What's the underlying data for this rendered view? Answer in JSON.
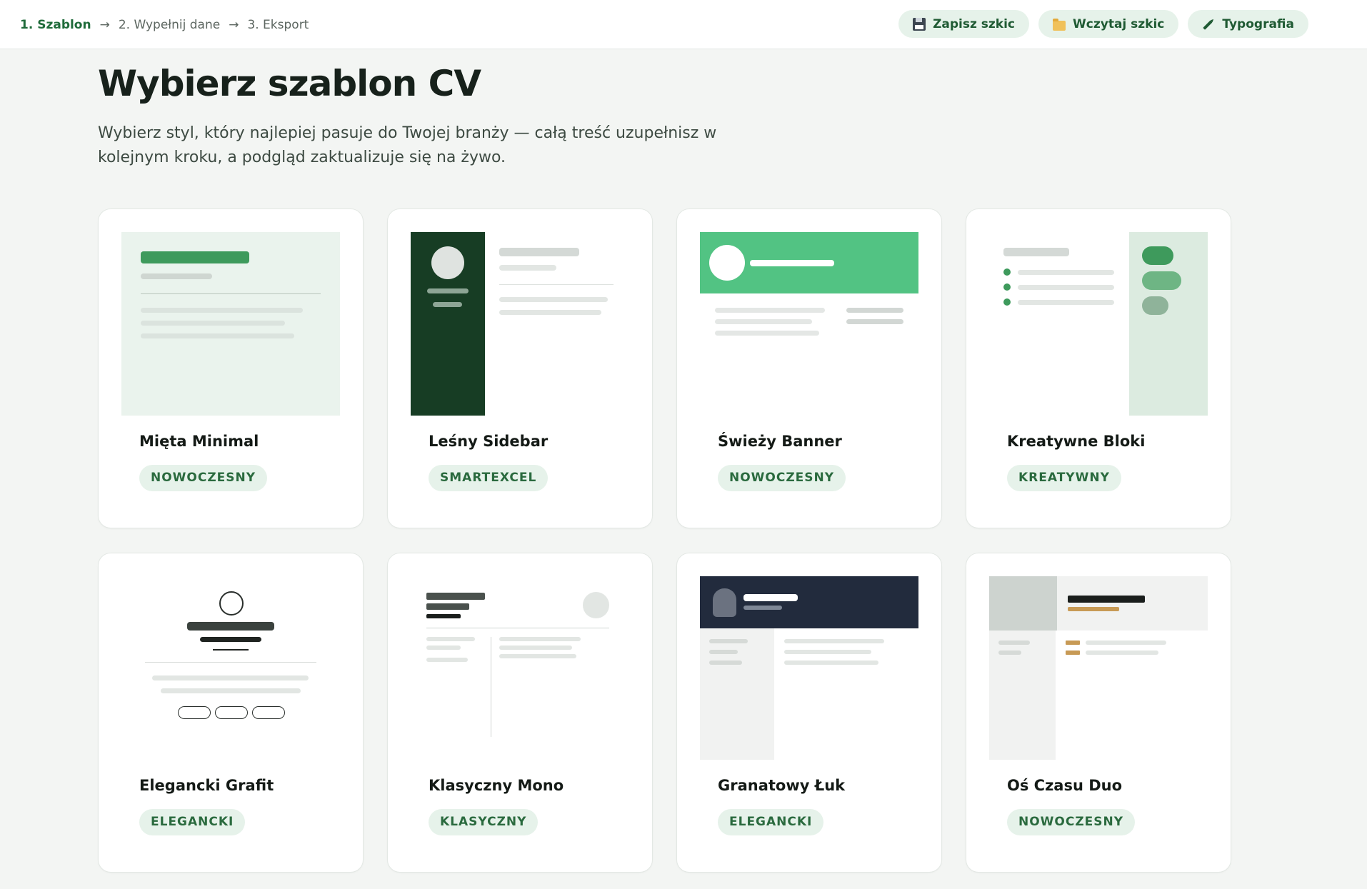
{
  "steps": [
    {
      "label": "1. Szablon"
    },
    {
      "label": "2. Wypełnij dane"
    },
    {
      "label": "3. Eksport"
    }
  ],
  "arrow": "→",
  "actions": [
    {
      "label": "Zapisz szkic",
      "icon": "floppy-disk-icon"
    },
    {
      "label": "Wczytaj szkic",
      "icon": "folder-icon"
    },
    {
      "label": "Typografia",
      "icon": "pen-icon"
    }
  ],
  "page": {
    "title": "Wybierz szablon CV",
    "subtitle": "Wybierz styl, który najlepiej pasuje do Twojej branży — całą treść uzupełnisz w kolejnym kroku, a podgląd zaktualizuje się na żywo."
  },
  "templates": [
    {
      "name": "Mięta Minimal",
      "badge": "NOWOCZESNY"
    },
    {
      "name": "Leśny Sidebar",
      "badge": "SMARTEXCEL"
    },
    {
      "name": "Świeży Banner",
      "badge": "NOWOCZESNY"
    },
    {
      "name": "Kreatywne Bloki",
      "badge": "KREATYWNY"
    },
    {
      "name": "Elegancki Grafit",
      "badge": "ELEGANCKI"
    },
    {
      "name": "Klasyczny Mono",
      "badge": "KLASYCZNY"
    },
    {
      "name": "Granatowy Łuk",
      "badge": "ELEGANCKI"
    },
    {
      "name": "Oś Czasu Duo",
      "badge": "NOWOCZESNY"
    }
  ],
  "colors": {
    "accent": "#1f6b3a",
    "mint": "#e9f3ec",
    "forest": "#173d24",
    "banner": "#52c383",
    "navy": "#222b3d"
  }
}
